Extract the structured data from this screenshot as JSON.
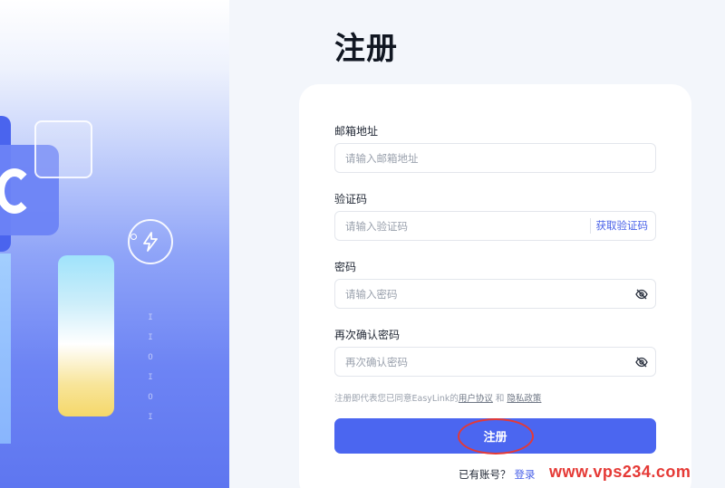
{
  "page": {
    "title": "注册"
  },
  "form": {
    "email": {
      "label": "邮箱地址",
      "placeholder": "请输入邮箱地址",
      "value": ""
    },
    "code": {
      "label": "验证码",
      "placeholder": "请输入验证码",
      "value": "",
      "action_label": "获取验证码"
    },
    "password": {
      "label": "密码",
      "placeholder": "请输入密码",
      "value": "",
      "toggle_icon": "eye-off-icon"
    },
    "confirm": {
      "label": "再次确认密码",
      "placeholder": "再次确认密码",
      "value": "",
      "toggle_icon": "eye-off-icon"
    },
    "agreement": {
      "prefix": "注册即代表您已同意EasyLink的",
      "terms_link": "用户协议",
      "joiner": " 和 ",
      "privacy_link": "隐私政策"
    },
    "submit_label": "注册",
    "login_prompt": "已有账号？",
    "login_link": "登录"
  },
  "colors": {
    "accent": "#4b66f0",
    "link": "#4a62e8",
    "annotation": "#e53935"
  },
  "watermark": "www.vps234.com"
}
